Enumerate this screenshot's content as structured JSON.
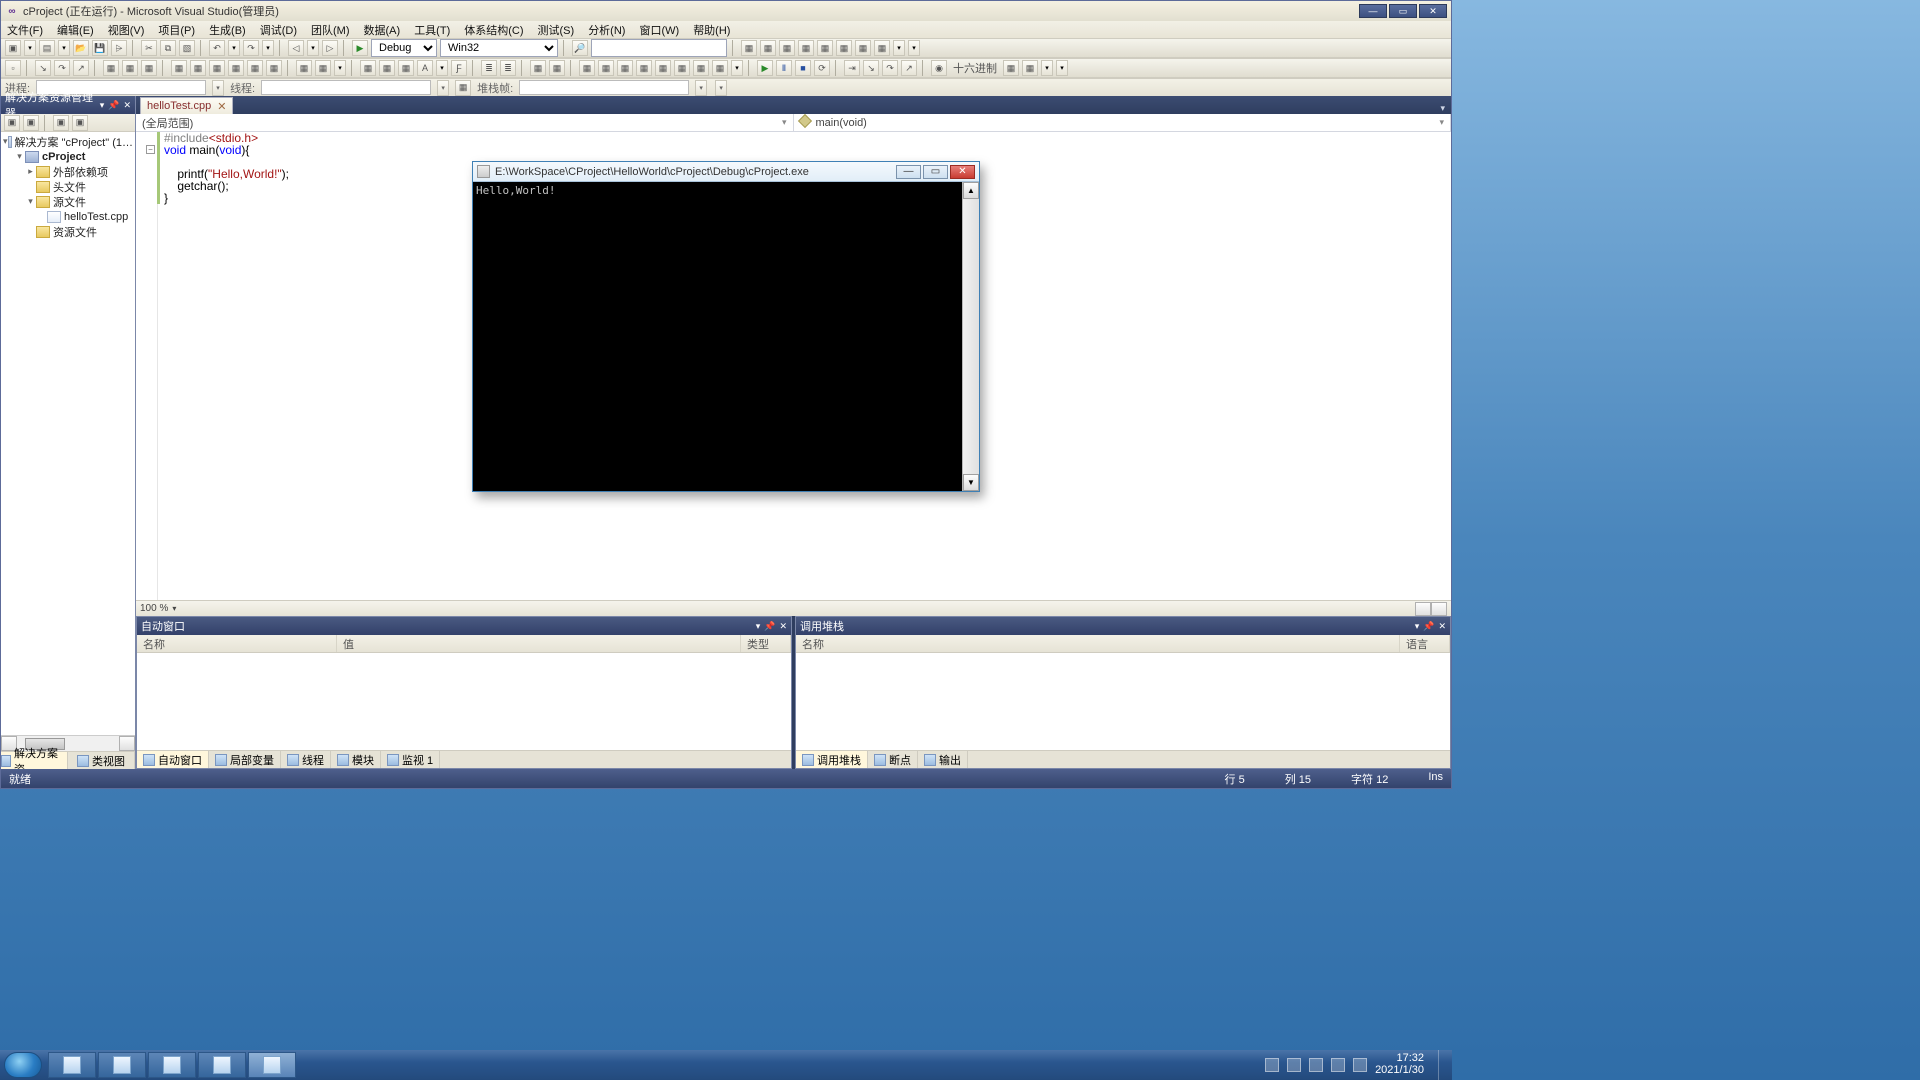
{
  "app": {
    "title": "cProject (正在运行) - Microsoft Visual Studio(管理员)"
  },
  "menu": [
    "文件(F)",
    "编辑(E)",
    "视图(V)",
    "项目(P)",
    "生成(B)",
    "调试(D)",
    "团队(M)",
    "数据(A)",
    "工具(T)",
    "体系结构(C)",
    "测试(S)",
    "分析(N)",
    "窗口(W)",
    "帮助(H)"
  ],
  "toolbar1": {
    "config": "Debug",
    "platform": "Win32",
    "findbox": ""
  },
  "toolbar2": {
    "numbase": "十六进制"
  },
  "procrow": {
    "proc_label": "进程:",
    "thread_label": "线程:",
    "stack_label": "堆栈帧:"
  },
  "solution": {
    "pane_title": "解决方案资源管理器",
    "root": "解决方案 \"cProject\" (1…",
    "project": "cProject",
    "folders": {
      "external": "外部依赖项",
      "headers": "头文件",
      "sources": "源文件",
      "resources": "资源文件"
    },
    "file": "helloTest.cpp",
    "bottom_tabs": {
      "explorer": "解决方案资…",
      "classview": "类视图"
    }
  },
  "editor": {
    "tab": "helloTest.cpp",
    "scope_left": "(全局范围)",
    "scope_right": "main(void)",
    "zoom": "100 %",
    "code": {
      "l1_inc": "#include",
      "l1_hdr": "<stdio.h>",
      "l2_void": "void",
      "l2_main": " main(",
      "l2_arg": "void",
      "l2_end": "){",
      "l4_printf": "    printf(",
      "l4_str": "\"Hello,World!\"",
      "l4_end": ");",
      "l5_getchar": "    getchar();",
      "l6": "}"
    }
  },
  "panes": {
    "autos": {
      "title": "自动窗口",
      "col_name": "名称",
      "col_value": "值",
      "col_type": "类型"
    },
    "callstack": {
      "title": "调用堆栈",
      "col_name": "名称",
      "col_lang": "语言"
    },
    "tabs_left": {
      "autos": "自动窗口",
      "locals": "局部变量",
      "threads": "线程",
      "modules": "模块",
      "watch": "监视 1"
    },
    "tabs_right": {
      "callstack": "调用堆栈",
      "breakpoints": "断点",
      "output": "输出"
    }
  },
  "status": {
    "ready": "就绪",
    "line": "行 5",
    "col": "列 15",
    "char": "字符 12",
    "ins": "Ins"
  },
  "console": {
    "title": "E:\\WorkSpace\\CProject\\HelloWorld\\cProject\\Debug\\cProject.exe",
    "output": "Hello,World!"
  },
  "taskbar": {
    "time": "17:32",
    "date": "2021/1/30"
  }
}
